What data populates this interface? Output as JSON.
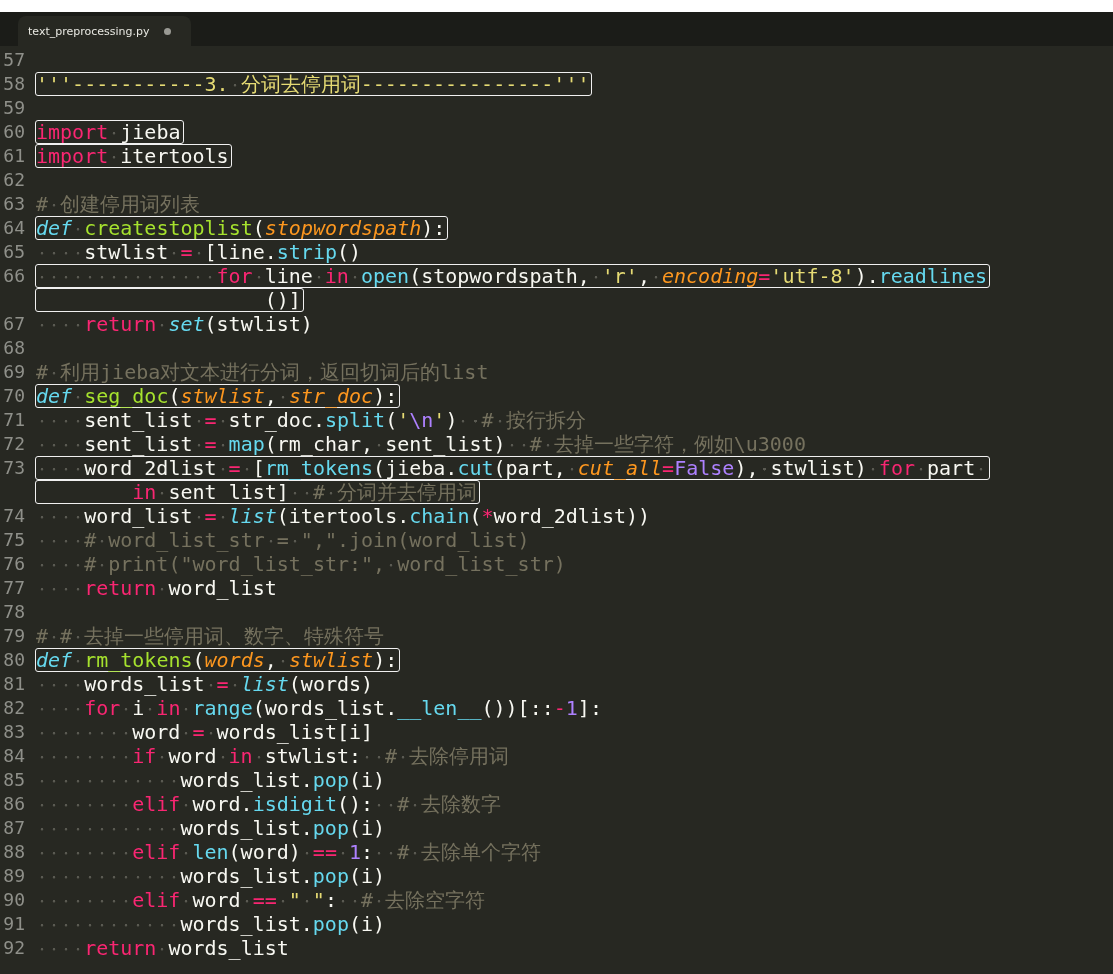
{
  "tab": {
    "title": "text_preprocessing.py",
    "selected": true,
    "modified": true
  },
  "lines": [
    {
      "number": "57"
    },
    {
      "number": "58",
      "boxed": true,
      "segments": [
        {
          "tokens": [
            {
              "kind": "string",
              "text": "'''-----------3. 分词去停用词----------------'''"
            }
          ]
        }
      ]
    },
    {
      "number": "59"
    },
    {
      "number": "60",
      "boxed": true,
      "segments": [
        {
          "tokens": [
            {
              "kind": "keyword",
              "text": "import"
            },
            {
              "kind": "plain",
              "text": " jieba"
            }
          ]
        }
      ]
    },
    {
      "number": "61",
      "boxed": true,
      "segments": [
        {
          "tokens": [
            {
              "kind": "keyword",
              "text": "import"
            },
            {
              "kind": "plain",
              "text": " itertools"
            }
          ]
        }
      ]
    },
    {
      "number": "62"
    },
    {
      "number": "63",
      "boxed": false,
      "segments": [
        {
          "tokens": [
            {
              "kind": "comment",
              "text": "# 创建停用词列表"
            }
          ]
        }
      ]
    },
    {
      "number": "64",
      "boxed": true,
      "segments": [
        {
          "tokens": [
            {
              "kind": "storage",
              "text": "def"
            },
            {
              "kind": "function",
              "text": " createstoplist"
            },
            {
              "kind": "plain",
              "text": "("
            },
            {
              "kind": "parameter",
              "text": "stopwordspath"
            },
            {
              "kind": "plain",
              "text": "):"
            }
          ]
        }
      ]
    },
    {
      "number": "65",
      "boxed": false,
      "segments": [
        {
          "tokens": [
            {
              "kind": "plain",
              "text": "    stwlist "
            },
            {
              "kind": "keyword",
              "text": "="
            },
            {
              "kind": "plain",
              "text": " [line."
            },
            {
              "kind": "support",
              "text": "strip"
            },
            {
              "kind": "plain",
              "text": "()"
            }
          ]
        }
      ]
    },
    {
      "number": "66",
      "boxed": true,
      "segments": [
        {
          "tokens": [
            {
              "kind": "keyword",
              "text": "               for"
            },
            {
              "kind": "plain",
              "text": " line "
            },
            {
              "kind": "keyword",
              "text": "in"
            },
            {
              "kind": "support",
              "text": " open"
            },
            {
              "kind": "plain",
              "text": "(stopwordspath, "
            },
            {
              "kind": "string",
              "text": "'r'"
            },
            {
              "kind": "plain",
              "text": ", "
            },
            {
              "kind": "parameter",
              "text": "encoding"
            },
            {
              "kind": "keyword",
              "text": "="
            },
            {
              "kind": "string",
              "text": "'utf-8'"
            },
            {
              "kind": "plain",
              "text": ")."
            },
            {
              "kind": "support",
              "text": "readlines"
            }
          ]
        },
        {
          "tokens": [
            {
              "kind": "plain",
              "text": "                   ()]"
            }
          ]
        }
      ]
    },
    {
      "number": "67",
      "boxed": false,
      "segments": [
        {
          "tokens": [
            {
              "kind": "keyword",
              "text": "    return"
            },
            {
              "kind": "builtin",
              "text": " set"
            },
            {
              "kind": "plain",
              "text": "(stwlist)"
            }
          ]
        }
      ]
    },
    {
      "number": "68"
    },
    {
      "number": "69",
      "boxed": false,
      "segments": [
        {
          "tokens": [
            {
              "kind": "comment",
              "text": "# 利用jieba对文本进行分词，返回切词后的list"
            }
          ]
        }
      ]
    },
    {
      "number": "70",
      "boxed": true,
      "segments": [
        {
          "tokens": [
            {
              "kind": "storage",
              "text": "def"
            },
            {
              "kind": "function",
              "text": " seg_doc"
            },
            {
              "kind": "plain",
              "text": "("
            },
            {
              "kind": "parameter",
              "text": "stwlist"
            },
            {
              "kind": "plain",
              "text": ", "
            },
            {
              "kind": "parameter",
              "text": "str_doc"
            },
            {
              "kind": "plain",
              "text": "):"
            }
          ]
        }
      ]
    },
    {
      "number": "71",
      "boxed": false,
      "segments": [
        {
          "tokens": [
            {
              "kind": "plain",
              "text": "    sent_list "
            },
            {
              "kind": "keyword",
              "text": "="
            },
            {
              "kind": "plain",
              "text": " str_doc."
            },
            {
              "kind": "support",
              "text": "split"
            },
            {
              "kind": "plain",
              "text": "("
            },
            {
              "kind": "string",
              "text": "'"
            },
            {
              "kind": "constant",
              "text": "\\n"
            },
            {
              "kind": "string",
              "text": "'"
            },
            {
              "kind": "plain",
              "text": ")  "
            },
            {
              "kind": "comment",
              "text": "# 按行拆分"
            }
          ]
        }
      ]
    },
    {
      "number": "72",
      "boxed": false,
      "segments": [
        {
          "tokens": [
            {
              "kind": "plain",
              "text": "    sent_list "
            },
            {
              "kind": "keyword",
              "text": "="
            },
            {
              "kind": "support",
              "text": " map"
            },
            {
              "kind": "plain",
              "text": "(rm_char, sent_list)  "
            },
            {
              "kind": "comment",
              "text": "# 去掉一些字符，例如\\u3000"
            }
          ]
        }
      ]
    },
    {
      "number": "73",
      "boxed": true,
      "segments": [
        {
          "tokens": [
            {
              "kind": "plain",
              "text": "    word_2dlist "
            },
            {
              "kind": "keyword",
              "text": "="
            },
            {
              "kind": "plain",
              "text": " ["
            },
            {
              "kind": "support",
              "text": "rm_tokens"
            },
            {
              "kind": "plain",
              "text": "(jieba."
            },
            {
              "kind": "support",
              "text": "cut"
            },
            {
              "kind": "plain",
              "text": "(part, "
            },
            {
              "kind": "parameter",
              "text": "cut_all"
            },
            {
              "kind": "keyword",
              "text": "="
            },
            {
              "kind": "constant",
              "text": "False"
            },
            {
              "kind": "plain",
              "text": "), stwlist) "
            },
            {
              "kind": "keyword",
              "text": "for"
            },
            {
              "kind": "plain",
              "text": " part "
            }
          ]
        },
        {
          "tokens": [
            {
              "kind": "keyword",
              "text": "        in"
            },
            {
              "kind": "plain",
              "text": " sent_list]  "
            },
            {
              "kind": "comment",
              "text": "# 分词并去停用词"
            }
          ]
        }
      ]
    },
    {
      "number": "74",
      "boxed": false,
      "segments": [
        {
          "tokens": [
            {
              "kind": "plain",
              "text": "    word_list "
            },
            {
              "kind": "keyword",
              "text": "="
            },
            {
              "kind": "builtin",
              "text": " list"
            },
            {
              "kind": "plain",
              "text": "(itertools."
            },
            {
              "kind": "support",
              "text": "chain"
            },
            {
              "kind": "plain",
              "text": "("
            },
            {
              "kind": "keyword",
              "text": "*"
            },
            {
              "kind": "plain",
              "text": "word_2dlist))"
            }
          ]
        }
      ]
    },
    {
      "number": "75",
      "boxed": false,
      "segments": [
        {
          "tokens": [
            {
              "kind": "comment",
              "text": "    # word_list_str = \",\".join(word_list)"
            }
          ]
        }
      ]
    },
    {
      "number": "76",
      "boxed": false,
      "segments": [
        {
          "tokens": [
            {
              "kind": "comment",
              "text": "    # print(\"word_list_str:\", word_list_str)"
            }
          ]
        }
      ]
    },
    {
      "number": "77",
      "boxed": false,
      "segments": [
        {
          "tokens": [
            {
              "kind": "keyword",
              "text": "    return"
            },
            {
              "kind": "plain",
              "text": " word_list"
            }
          ]
        }
      ]
    },
    {
      "number": "78"
    },
    {
      "number": "79",
      "boxed": false,
      "segments": [
        {
          "tokens": [
            {
              "kind": "comment",
              "text": "# # 去掉一些停用词、数字、特殊符号"
            }
          ]
        }
      ]
    },
    {
      "number": "80",
      "boxed": true,
      "segments": [
        {
          "tokens": [
            {
              "kind": "storage",
              "text": "def"
            },
            {
              "kind": "function",
              "text": " rm_tokens"
            },
            {
              "kind": "plain",
              "text": "("
            },
            {
              "kind": "parameter",
              "text": "words"
            },
            {
              "kind": "plain",
              "text": ", "
            },
            {
              "kind": "parameter",
              "text": "stwlist"
            },
            {
              "kind": "plain",
              "text": "):"
            }
          ]
        }
      ]
    },
    {
      "number": "81",
      "boxed": false,
      "segments": [
        {
          "tokens": [
            {
              "kind": "plain",
              "text": "    words_list "
            },
            {
              "kind": "keyword",
              "text": "="
            },
            {
              "kind": "builtin",
              "text": " list"
            },
            {
              "kind": "plain",
              "text": "(words)"
            }
          ]
        }
      ]
    },
    {
      "number": "82",
      "boxed": false,
      "segments": [
        {
          "tokens": [
            {
              "kind": "keyword",
              "text": "    for"
            },
            {
              "kind": "plain",
              "text": " i "
            },
            {
              "kind": "keyword",
              "text": "in"
            },
            {
              "kind": "support",
              "text": " range"
            },
            {
              "kind": "plain",
              "text": "(words_list."
            },
            {
              "kind": "support",
              "text": "__len__"
            },
            {
              "kind": "plain",
              "text": "())[::"
            },
            {
              "kind": "keyword",
              "text": "-"
            },
            {
              "kind": "constant",
              "text": "1"
            },
            {
              "kind": "plain",
              "text": "]:"
            }
          ]
        }
      ]
    },
    {
      "number": "83",
      "boxed": false,
      "segments": [
        {
          "tokens": [
            {
              "kind": "plain",
              "text": "        word "
            },
            {
              "kind": "keyword",
              "text": "="
            },
            {
              "kind": "plain",
              "text": " words_list[i]"
            }
          ]
        }
      ]
    },
    {
      "number": "84",
      "boxed": false,
      "segments": [
        {
          "tokens": [
            {
              "kind": "keyword",
              "text": "        if"
            },
            {
              "kind": "plain",
              "text": " word "
            },
            {
              "kind": "keyword",
              "text": "in"
            },
            {
              "kind": "plain",
              "text": " stwlist:  "
            },
            {
              "kind": "comment",
              "text": "# 去除停用词"
            }
          ]
        }
      ]
    },
    {
      "number": "85",
      "boxed": false,
      "segments": [
        {
          "tokens": [
            {
              "kind": "plain",
              "text": "            words_list."
            },
            {
              "kind": "support",
              "text": "pop"
            },
            {
              "kind": "plain",
              "text": "(i)"
            }
          ]
        }
      ]
    },
    {
      "number": "86",
      "boxed": false,
      "segments": [
        {
          "tokens": [
            {
              "kind": "keyword",
              "text": "        elif"
            },
            {
              "kind": "plain",
              "text": " word."
            },
            {
              "kind": "support",
              "text": "isdigit"
            },
            {
              "kind": "plain",
              "text": "():  "
            },
            {
              "kind": "comment",
              "text": "# 去除数字"
            }
          ]
        }
      ]
    },
    {
      "number": "87",
      "boxed": false,
      "segments": [
        {
          "tokens": [
            {
              "kind": "plain",
              "text": "            words_list."
            },
            {
              "kind": "support",
              "text": "pop"
            },
            {
              "kind": "plain",
              "text": "(i)"
            }
          ]
        }
      ]
    },
    {
      "number": "88",
      "boxed": false,
      "segments": [
        {
          "tokens": [
            {
              "kind": "keyword",
              "text": "        elif"
            },
            {
              "kind": "support",
              "text": " len"
            },
            {
              "kind": "plain",
              "text": "(word) "
            },
            {
              "kind": "keyword",
              "text": "=="
            },
            {
              "kind": "constant",
              "text": " 1"
            },
            {
              "kind": "plain",
              "text": ":  "
            },
            {
              "kind": "comment",
              "text": "# 去除单个字符"
            }
          ]
        }
      ]
    },
    {
      "number": "89",
      "boxed": false,
      "segments": [
        {
          "tokens": [
            {
              "kind": "plain",
              "text": "            words_list."
            },
            {
              "kind": "support",
              "text": "pop"
            },
            {
              "kind": "plain",
              "text": "(i)"
            }
          ]
        }
      ]
    },
    {
      "number": "90",
      "boxed": false,
      "segments": [
        {
          "tokens": [
            {
              "kind": "keyword",
              "text": "        elif"
            },
            {
              "kind": "plain",
              "text": " word "
            },
            {
              "kind": "keyword",
              "text": "=="
            },
            {
              "kind": "string",
              "text": " \" \""
            },
            {
              "kind": "plain",
              "text": ":  "
            },
            {
              "kind": "comment",
              "text": "# 去除空字符"
            }
          ]
        }
      ]
    },
    {
      "number": "91",
      "boxed": false,
      "segments": [
        {
          "tokens": [
            {
              "kind": "plain",
              "text": "            words_list."
            },
            {
              "kind": "support",
              "text": "pop"
            },
            {
              "kind": "plain",
              "text": "(i)"
            }
          ]
        }
      ]
    },
    {
      "number": "92",
      "boxed": false,
      "segments": [
        {
          "tokens": [
            {
              "kind": "keyword",
              "text": "    return"
            },
            {
              "kind": "plain",
              "text": " words_list"
            }
          ]
        }
      ]
    }
  ]
}
